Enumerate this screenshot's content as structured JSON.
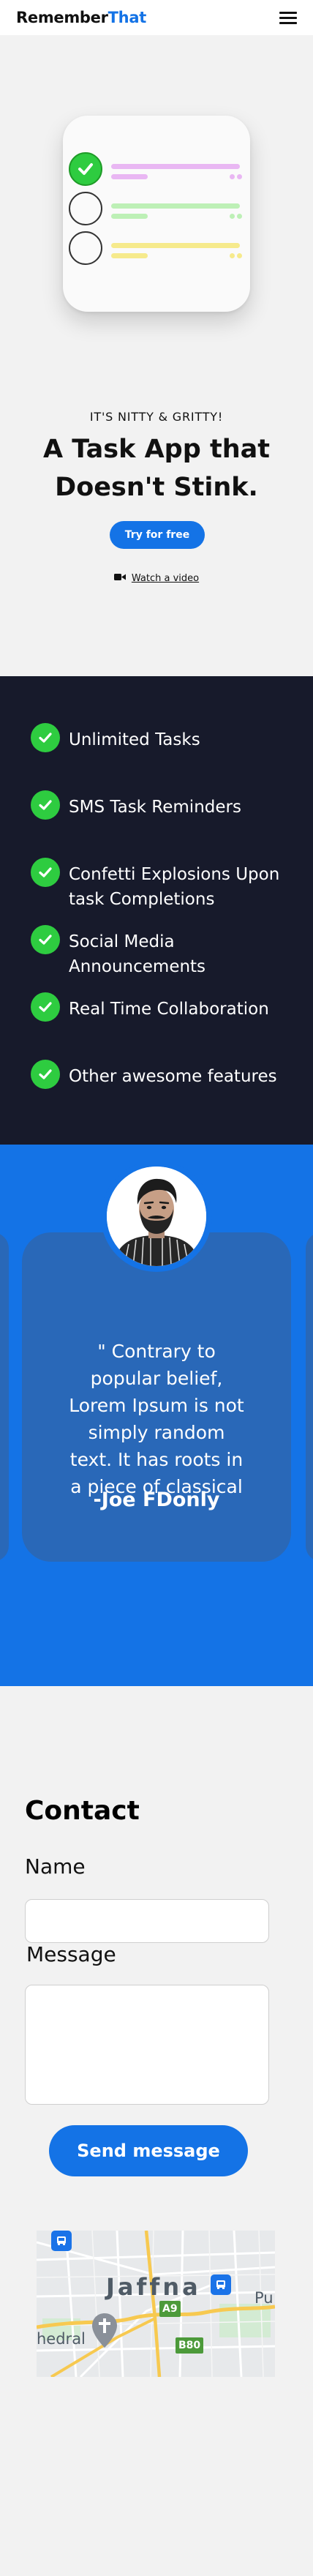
{
  "header": {
    "brand_part1": "Remember",
    "brand_part2": "That",
    "menu_icon": "hamburger-menu-icon"
  },
  "hero": {
    "eyebrow": "IT'S NITTY & GRITTY!",
    "headline_line1": "A Task App that",
    "headline_line2": "Doesn't Stink.",
    "cta_label": "Try for free",
    "watch_label": "Watch a video",
    "watch_icon": "video-camera-icon"
  },
  "features": {
    "items": [
      "Unlimited Tasks",
      "SMS Task Reminders",
      "Confetti Explosions Upon task Completions",
      "Social Media Announcements",
      "Real Time Collaboration",
      "Other awesome features"
    ]
  },
  "testimonial": {
    "quote": "\" Contrary to popular belief, Lorem Ipsum is not simply random text. It has roots in a piece of classical",
    "author": "-Joe FDonly"
  },
  "contact": {
    "title": "Contact",
    "name_label": "Name",
    "message_label": "Message",
    "send_label": "Send message",
    "map": {
      "city": "Jaffna",
      "label_right": "Pu",
      "label_left": "hedral",
      "route_a9": "A9",
      "route_b80": "B80"
    }
  },
  "colors": {
    "accent": "#1473e6",
    "dark": "#171a2b",
    "check_green": "#2ecc40",
    "card_blue": "#2968b8"
  }
}
